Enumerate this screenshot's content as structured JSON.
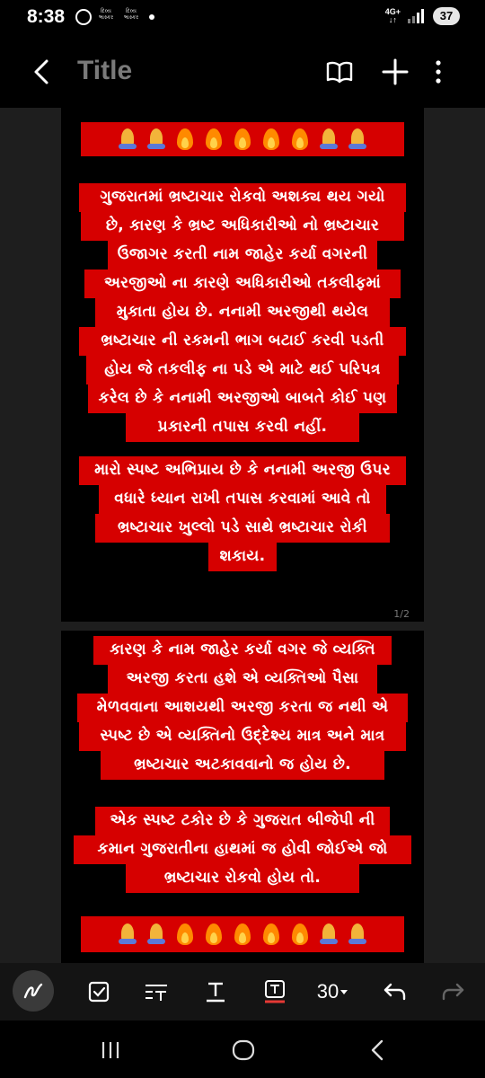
{
  "status_bar": {
    "time": "8:38",
    "network_top": "4G+",
    "network_bottom": "↓↑",
    "battery": "37",
    "news_badge_1": "દિવ્ય ભાસ્કર",
    "news_badge_2": "દિવ્ય ભાસ્કર"
  },
  "app_bar": {
    "title": "Title",
    "icons": [
      "back-icon",
      "book-icon",
      "add-icon",
      "more-vert-icon"
    ]
  },
  "document": {
    "page1": {
      "emoji_row": [
        "pray",
        "pray",
        "fire",
        "fire",
        "fire",
        "fire",
        "fire",
        "pray",
        "pray"
      ],
      "paragraph1_lines": [
        "ગુજરાતમાં ભ્રષ્ટાચાર રોકવો અશક્ય થય ગયો",
        "છે, કારણ કે ભ્રષ્ટ અધિકારીઓ નો ભ્રષ્ટાચાર",
        "ઉજાગર કરતી નામ જાહેર કર્યા વગરની",
        "અરજીઓ ના કારણે અધિકારીઓ તકલીફમાં",
        "મુકાતા હોય છે. નનામી અરજીથી થયેલ",
        "ભ્રષ્ટાચાર ની રકમની ભાગ બટાઈ કરવી પડતી",
        "હોય જે તકલીફ ના પડે એ માટે થઈ પરિપત્ર",
        "કરેલ છે કે નનામી અરજીઓ બાબતે કોઈ પણ",
        "પ્રકારની તપાસ કરવી નહીં."
      ],
      "paragraph2_lines": [
        "મારો સ્પષ્ટ અભિપ્રાય છે કે નનામી અરજી ઉપર",
        "વધારે ધ્યાન રાખી તપાસ કરવામાં આવે તો",
        "ભ્રષ્ટાચાર ખુલ્લો પડે સાથે ભ્રષ્ટાચાર રોકી",
        "શકાય."
      ],
      "page_number": "1/2"
    },
    "page2": {
      "paragraph1_lines": [
        "કારણ કે નામ જાહેર કર્યા વગર જે વ્યક્તિ",
        "અરજી કરતા હશે એ વ્યક્તિઓ પૈસા",
        "મેળવવાના આશયથી અરજી કરતા જ નથી એ",
        "સ્પષ્ટ છે એ વ્યક્તિનો ઉદ્દેશ્ય માત્ર અને માત્ર",
        "ભ્રષ્ટાચાર અટકાવવાનો જ હોય છે."
      ],
      "paragraph2_lines": [
        "એક સ્પષ્ટ ટકોર છે કે ગુજરાત બીજેપી ની",
        "કમાન ગુજરાતીના હાથમાં જ હોવી જોઈએ જો",
        "ભ્રષ્ટાચાર રોકવો હોય તો."
      ],
      "emoji_row": [
        "pray",
        "pray",
        "fire",
        "fire",
        "fire",
        "fire",
        "fire",
        "pray",
        "pray"
      ]
    }
  },
  "toolbar": {
    "font_size": "30",
    "icons": [
      "pen-icon",
      "checkbox-icon",
      "text-style-icon",
      "underline-text-icon",
      "text-color-icon",
      "undo-icon",
      "redo-icon"
    ]
  },
  "navbar": {
    "icons": [
      "recents-icon",
      "home-icon",
      "back-nav-icon"
    ]
  },
  "colors": {
    "highlight": "#d60000",
    "page_bg": "#000000",
    "canvas_bg": "#1e1e1e",
    "title_gray": "#7a7a7a"
  }
}
